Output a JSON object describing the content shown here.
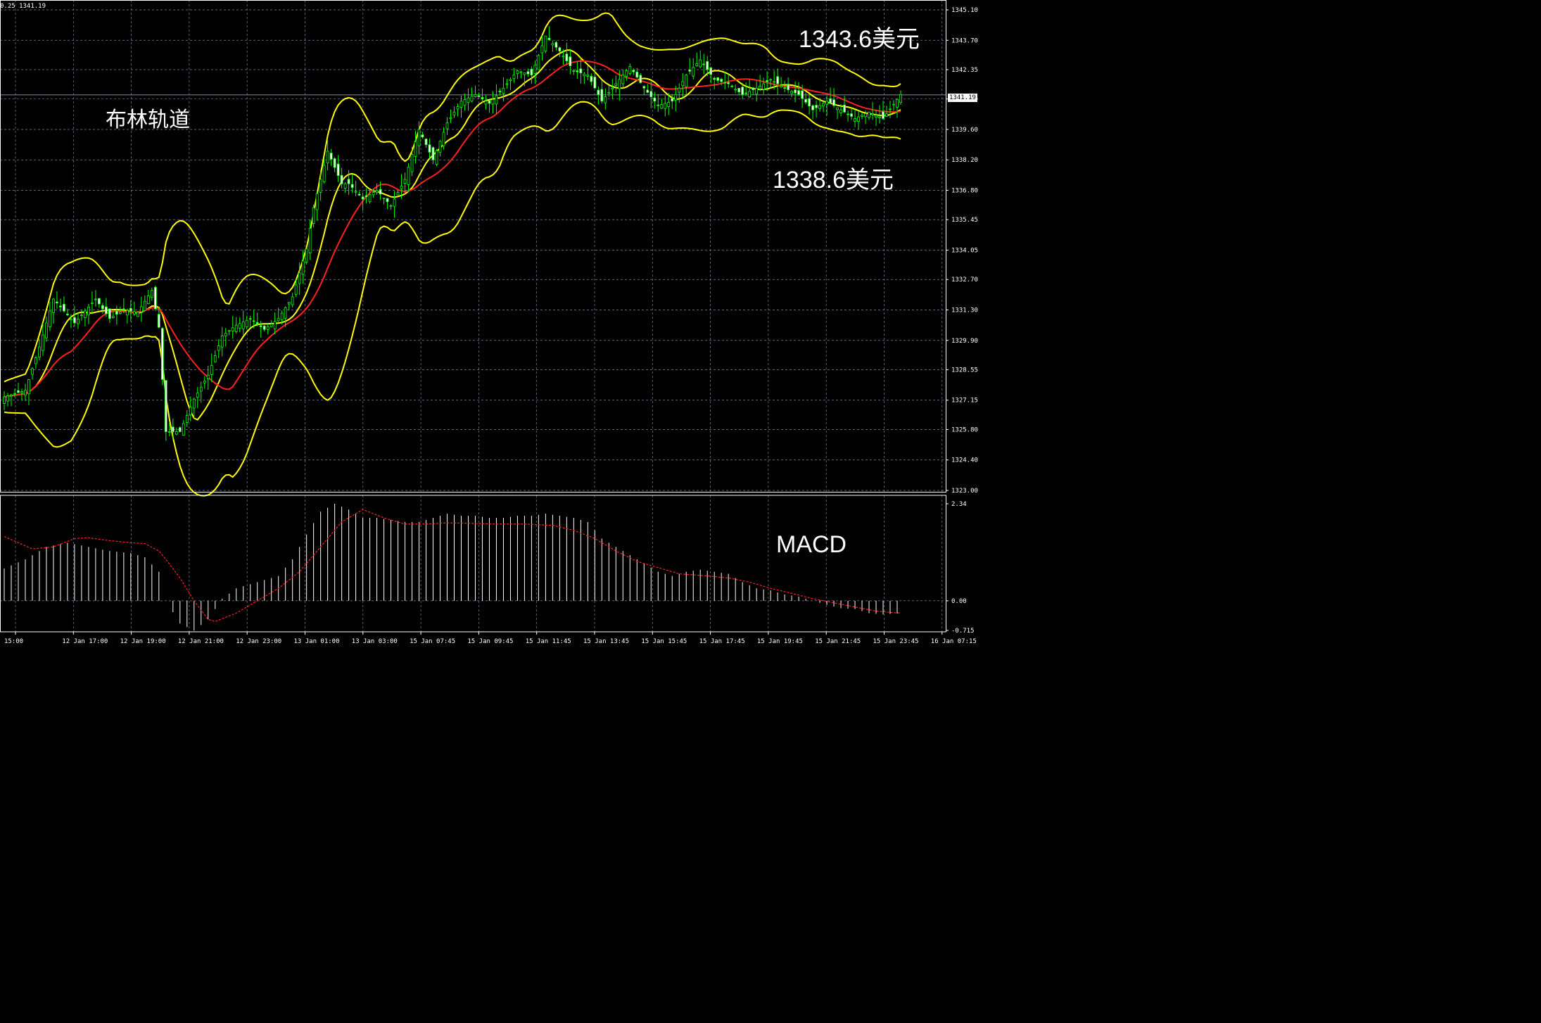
{
  "header": {
    "text": "0.25 1341.19"
  },
  "current_price_tag": "1341.19",
  "annotations": {
    "title": "布林轨道",
    "upper_value": "1343.6美元",
    "lower_value": "1338.6美元",
    "macd": "MACD"
  },
  "colors": {
    "background": "#000000",
    "grid": "#7a8699",
    "candle_up": "#00ff00",
    "candle_down": "#ffffff",
    "bollinger_band": "#ffff00",
    "bollinger_mid": "#ff2020",
    "macd_hist": "#ffffff",
    "macd_signal": "#ff2020"
  },
  "chart_data": [
    {
      "type": "candlestick",
      "title": "布林轨道",
      "y_ticks": [
        "1345.10",
        "1343.70",
        "1342.35",
        "1341.00",
        "1339.60",
        "1338.20",
        "1336.80",
        "1335.45",
        "1334.05",
        "1332.70",
        "1331.30",
        "1329.90",
        "1328.55",
        "1327.15",
        "1325.80",
        "1324.40",
        "1323.00"
      ],
      "ylim": [
        1323.0,
        1345.1
      ],
      "x_ticks": [
        "15:00",
        "12 Jan 17:00",
        "12 Jan 19:00",
        "12 Jan 21:00",
        "12 Jan 23:00",
        "13 Jan 01:00",
        "13 Jan 03:00",
        "15 Jan 07:45",
        "15 Jan 09:45",
        "15 Jan 11:45",
        "15 Jan 13:45",
        "15 Jan 15:45",
        "15 Jan 17:45",
        "15 Jan 19:45",
        "15 Jan 21:45",
        "15 Jan 23:45",
        "16 Jan 07:15"
      ],
      "last_price": 1341.19,
      "grid": true,
      "indicators": [
        "Bollinger Bands",
        "Bollinger middle band"
      ],
      "close_anchors": [
        [
          0,
          1327.3
        ],
        [
          6,
          1327.6
        ],
        [
          10,
          1329.6
        ],
        [
          14,
          1331.8
        ],
        [
          20,
          1330.7
        ],
        [
          26,
          1331.8
        ],
        [
          30,
          1330.9
        ],
        [
          34,
          1331.3
        ],
        [
          38,
          1331.2
        ],
        [
          42,
          1332.2
        ],
        [
          44,
          1330.5
        ],
        [
          46,
          1325.7
        ],
        [
          50,
          1325.7
        ],
        [
          54,
          1327.2
        ],
        [
          58,
          1328.3
        ],
        [
          62,
          1330.1
        ],
        [
          66,
          1330.6
        ],
        [
          70,
          1330.9
        ],
        [
          74,
          1330.4
        ],
        [
          78,
          1330.9
        ],
        [
          82,
          1331.9
        ],
        [
          86,
          1334.1
        ],
        [
          88,
          1336.0
        ],
        [
          92,
          1338.6
        ],
        [
          96,
          1337.1
        ],
        [
          98,
          1337.1
        ],
        [
          102,
          1336.4
        ],
        [
          106,
          1336.8
        ],
        [
          110,
          1336.1
        ],
        [
          114,
          1337.3
        ],
        [
          118,
          1339.6
        ],
        [
          122,
          1338.2
        ],
        [
          126,
          1339.9
        ],
        [
          130,
          1340.9
        ],
        [
          134,
          1341.2
        ],
        [
          138,
          1340.8
        ],
        [
          142,
          1341.5
        ],
        [
          146,
          1342.3
        ],
        [
          150,
          1342.1
        ],
        [
          154,
          1343.9
        ],
        [
          158,
          1343.2
        ],
        [
          162,
          1342.3
        ],
        [
          166,
          1342.1
        ],
        [
          170,
          1340.9
        ],
        [
          174,
          1341.7
        ],
        [
          178,
          1342.5
        ],
        [
          182,
          1341.5
        ],
        [
          186,
          1340.7
        ],
        [
          190,
          1340.9
        ],
        [
          194,
          1342.1
        ],
        [
          198,
          1342.8
        ],
        [
          202,
          1341.9
        ],
        [
          206,
          1341.7
        ],
        [
          210,
          1341.2
        ],
        [
          214,
          1341.5
        ],
        [
          218,
          1341.9
        ],
        [
          222,
          1341.5
        ],
        [
          226,
          1341.2
        ],
        [
          230,
          1340.5
        ],
        [
          234,
          1340.9
        ],
        [
          238,
          1340.5
        ],
        [
          242,
          1340.1
        ],
        [
          246,
          1340.4
        ],
        [
          250,
          1340.1
        ],
        [
          255,
          1341.2
        ]
      ]
    },
    {
      "type": "bar",
      "title": "MACD",
      "y_ticks": [
        "2.34",
        "0.00",
        "-0.715"
      ],
      "ylim": [
        -0.715,
        2.34
      ],
      "series": [
        {
          "values_from": "histogram"
        },
        {
          "values_from": "signal"
        }
      ],
      "hist_anchors": [
        [
          0,
          0.78
        ],
        [
          6,
          1.0
        ],
        [
          12,
          1.3
        ],
        [
          18,
          1.4
        ],
        [
          24,
          1.3
        ],
        [
          30,
          1.2
        ],
        [
          36,
          1.15
        ],
        [
          40,
          1.05
        ],
        [
          44,
          0.7
        ],
        [
          46,
          0.0
        ],
        [
          50,
          -0.55
        ],
        [
          54,
          -0.72
        ],
        [
          58,
          -0.45
        ],
        [
          62,
          0.05
        ],
        [
          66,
          0.3
        ],
        [
          70,
          0.4
        ],
        [
          74,
          0.5
        ],
        [
          78,
          0.6
        ],
        [
          82,
          1.0
        ],
        [
          86,
          1.6
        ],
        [
          90,
          2.15
        ],
        [
          94,
          2.34
        ],
        [
          98,
          2.2
        ],
        [
          102,
          2.0
        ],
        [
          106,
          2.0
        ],
        [
          110,
          1.95
        ],
        [
          114,
          1.9
        ],
        [
          118,
          1.9
        ],
        [
          122,
          2.0
        ],
        [
          126,
          2.1
        ],
        [
          130,
          2.05
        ],
        [
          134,
          2.05
        ],
        [
          138,
          2.0
        ],
        [
          142,
          2.0
        ],
        [
          146,
          2.05
        ],
        [
          150,
          2.05
        ],
        [
          154,
          2.1
        ],
        [
          158,
          2.05
        ],
        [
          162,
          2.0
        ],
        [
          166,
          1.9
        ],
        [
          170,
          1.5
        ],
        [
          174,
          1.3
        ],
        [
          178,
          1.1
        ],
        [
          182,
          0.9
        ],
        [
          186,
          0.7
        ],
        [
          190,
          0.6
        ],
        [
          194,
          0.7
        ],
        [
          198,
          0.75
        ],
        [
          202,
          0.7
        ],
        [
          206,
          0.65
        ],
        [
          210,
          0.45
        ],
        [
          214,
          0.3
        ],
        [
          218,
          0.25
        ],
        [
          222,
          0.15
        ],
        [
          226,
          0.1
        ],
        [
          230,
          0.0
        ],
        [
          234,
          -0.1
        ],
        [
          238,
          -0.18
        ],
        [
          242,
          -0.2
        ],
        [
          246,
          -0.3
        ],
        [
          250,
          -0.33
        ],
        [
          255,
          -0.3
        ]
      ],
      "signal_anchors": [
        [
          0,
          1.55
        ],
        [
          8,
          1.25
        ],
        [
          14,
          1.3
        ],
        [
          20,
          1.5
        ],
        [
          24,
          1.52
        ],
        [
          30,
          1.45
        ],
        [
          36,
          1.4
        ],
        [
          40,
          1.38
        ],
        [
          44,
          1.2
        ],
        [
          46,
          1.0
        ],
        [
          50,
          0.55
        ],
        [
          54,
          0.0
        ],
        [
          58,
          -0.45
        ],
        [
          60,
          -0.5
        ],
        [
          66,
          -0.3
        ],
        [
          72,
          0.0
        ],
        [
          78,
          0.3
        ],
        [
          84,
          0.7
        ],
        [
          90,
          1.3
        ],
        [
          96,
          1.9
        ],
        [
          102,
          2.2
        ],
        [
          108,
          2.0
        ],
        [
          114,
          1.85
        ],
        [
          120,
          1.85
        ],
        [
          126,
          1.88
        ],
        [
          132,
          1.87
        ],
        [
          140,
          1.85
        ],
        [
          148,
          1.85
        ],
        [
          156,
          1.82
        ],
        [
          162,
          1.7
        ],
        [
          168,
          1.5
        ],
        [
          174,
          1.2
        ],
        [
          180,
          0.95
        ],
        [
          186,
          0.8
        ],
        [
          192,
          0.65
        ],
        [
          200,
          0.6
        ],
        [
          206,
          0.55
        ],
        [
          212,
          0.45
        ],
        [
          218,
          0.3
        ],
        [
          224,
          0.18
        ],
        [
          230,
          0.05
        ],
        [
          236,
          -0.05
        ],
        [
          242,
          -0.15
        ],
        [
          248,
          -0.25
        ],
        [
          255,
          -0.3
        ]
      ]
    }
  ]
}
